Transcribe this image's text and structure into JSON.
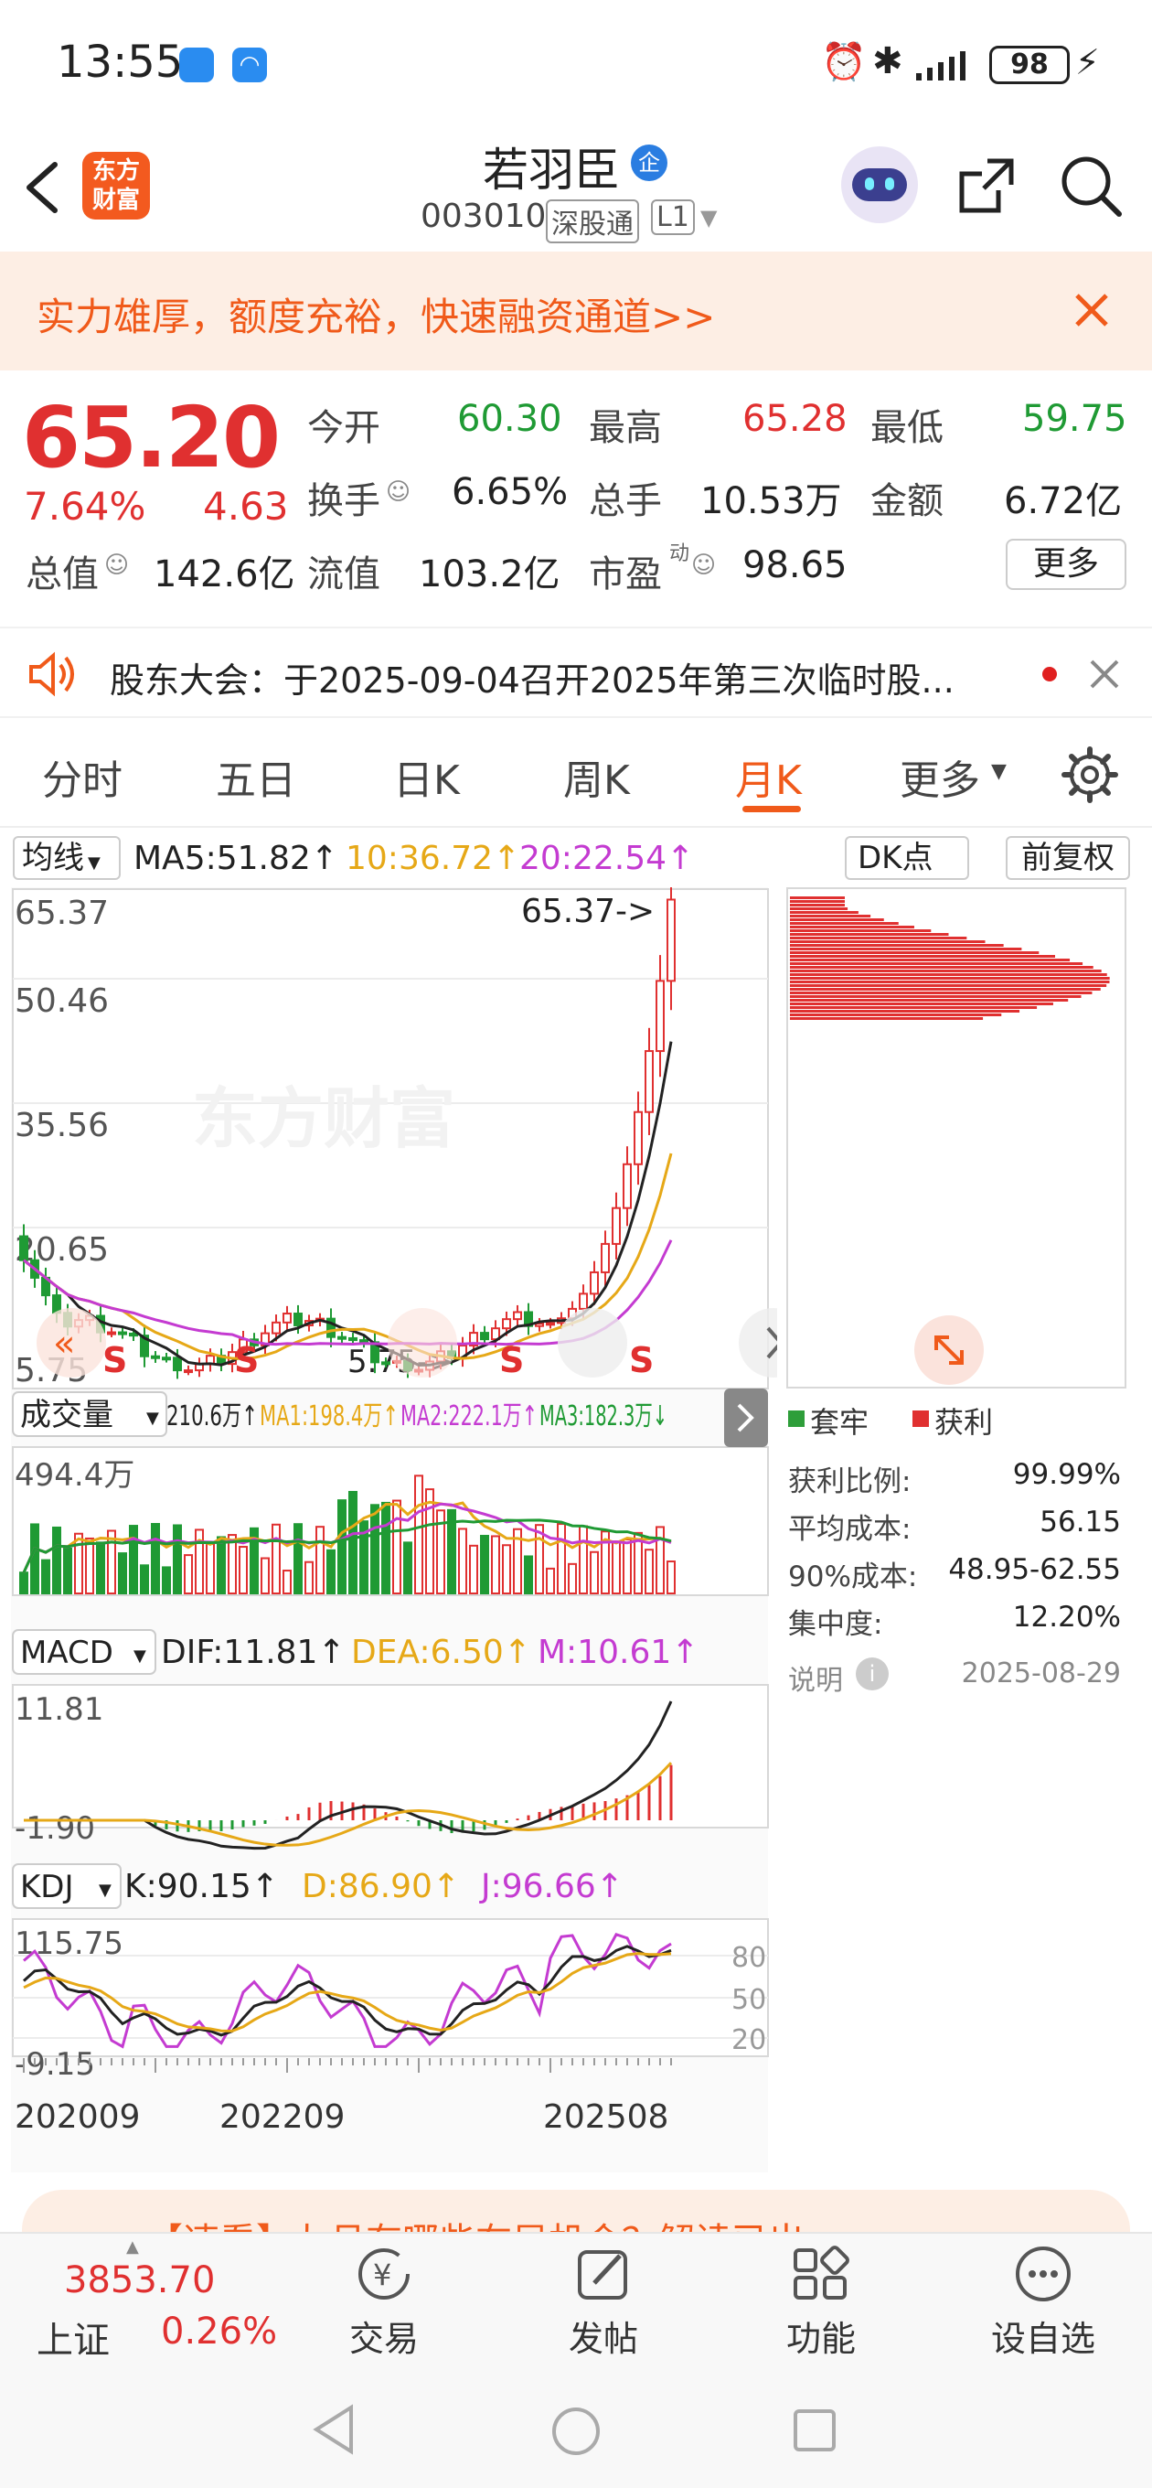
{
  "status_bar": {
    "time": "13:55",
    "battery": "98"
  },
  "header": {
    "stock_name": "若羽臣",
    "badge": "企",
    "code": "003010",
    "exchange_tag": "深股通",
    "level_tag": "L1",
    "logo_line1": "东方",
    "logo_line2": "财富"
  },
  "banner": {
    "text": "实力雄厚，额度充裕，快速融资通道>>"
  },
  "quote": {
    "price": "65.20",
    "change_pct": "7.64%",
    "change_amt": "4.63",
    "open_label": "今开",
    "open": "60.30",
    "high_label": "最高",
    "high": "65.28",
    "low_label": "最低",
    "low": "59.75",
    "turnover_label": "换手",
    "turnover": "6.65%",
    "volume_label": "总手",
    "volume": "10.53万",
    "amount_label": "金额",
    "amount": "6.72亿",
    "mktcap_label": "总值",
    "mktcap": "142.6亿",
    "float_label": "流值",
    "float": "103.2亿",
    "pe_label": "市盈",
    "pe_sup": "动",
    "pe": "98.65",
    "more_label": "更多"
  },
  "notice": {
    "text": "股东大会：于2025-09-04召开2025年第三次临时股..."
  },
  "tabs": [
    "分时",
    "五日",
    "日K",
    "周K",
    "月K",
    "更多"
  ],
  "active_tab": 4,
  "chart_toolbar": {
    "ma_select": "均线",
    "ma5": "MA5:51.82↑",
    "ma10": "10:36.72↑",
    "ma20": "20:22.54↑",
    "dk_label": "DK点",
    "adjust_label": "前复权"
  },
  "kline": {
    "y_labels": [
      "65.37",
      "50.46",
      "35.56",
      "20.65",
      "5.75"
    ],
    "max_marker": "65.37->",
    "min_marker": "5.75->",
    "s_label": "S",
    "watermark": "东方财富"
  },
  "volume_bar": {
    "label": "成交量",
    "current": "210.6万↑",
    "ma1": "MA1:198.4万↑",
    "ma2": "MA2:222.1万↑",
    "ma3": "MA3:182.3万↓",
    "y_max": "494.4万"
  },
  "macd_bar": {
    "label": "MACD",
    "dif": "DIF:11.81↑",
    "dea": "DEA:6.50↑",
    "m": "M:10.61↑",
    "y_max": "11.81",
    "y_min": "-1.90"
  },
  "kdj_bar": {
    "label": "KDJ",
    "k": "K:90.15↑",
    "d": "D:86.90↑",
    "j": "J:96.66↑",
    "y_max": "115.75",
    "y_min": "-9.15",
    "levels": [
      "80",
      "50",
      "20"
    ]
  },
  "x_labels": [
    "202009",
    "202209",
    "202508"
  ],
  "chips": {
    "legend_trapped": "套牢",
    "legend_profit": "获利",
    "rows": [
      {
        "label": "获利比例:",
        "value": "99.99%"
      },
      {
        "label": "平均成本:",
        "value": "56.15"
      },
      {
        "label": "90%成本:",
        "value": "48.95-62.55"
      },
      {
        "label": "集中度:",
        "value": "12.20%"
      }
    ],
    "note_label": "说明",
    "date": "2025-08-29"
  },
  "news_ticker": {
    "text": "【速看】九月有哪些布局机会？解读已出>>>"
  },
  "bottom_bar": {
    "index_value": "3853.70",
    "index_name": "上证",
    "index_pct": "0.26%",
    "trade": "交易",
    "post": "发帖",
    "functions": "功能",
    "watchlist": "设自选"
  },
  "chart_data": {
    "type": "candlestick",
    "period": "monthly",
    "x_range": [
      "2020-09",
      "2025-08"
    ],
    "ylim": [
      5.75,
      65.37
    ],
    "last_close": 65.2,
    "ma": {
      "MA5": 51.82,
      "MA10": 36.72,
      "MA20": 22.54
    },
    "volume_max": "494.4万",
    "macd": {
      "DIF": 11.81,
      "DEA": 6.5,
      "M": 10.61
    },
    "kdj": {
      "K": 90.15,
      "D": 86.9,
      "J": 96.66
    }
  }
}
